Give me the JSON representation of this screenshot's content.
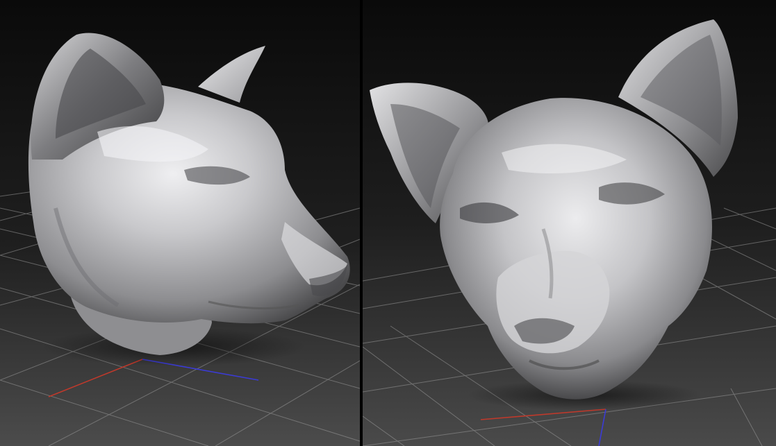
{
  "scene": {
    "viewports": [
      {
        "id": "left",
        "subject": "sculpted-cat-head-three-quarter-view"
      },
      {
        "id": "right",
        "subject": "sculpted-cat-head-front-view"
      }
    ],
    "colors": {
      "background_top": "#0c0c0c",
      "background_bottom": "#4a4a4a",
      "grid_line": "#9a9a9a",
      "x_axis": "#c0392b",
      "z_axis": "#3b3bd6",
      "clay_light": "#e4e4e6",
      "clay_mid": "#a9a9ac",
      "clay_dark": "#3a3a3c"
    }
  }
}
